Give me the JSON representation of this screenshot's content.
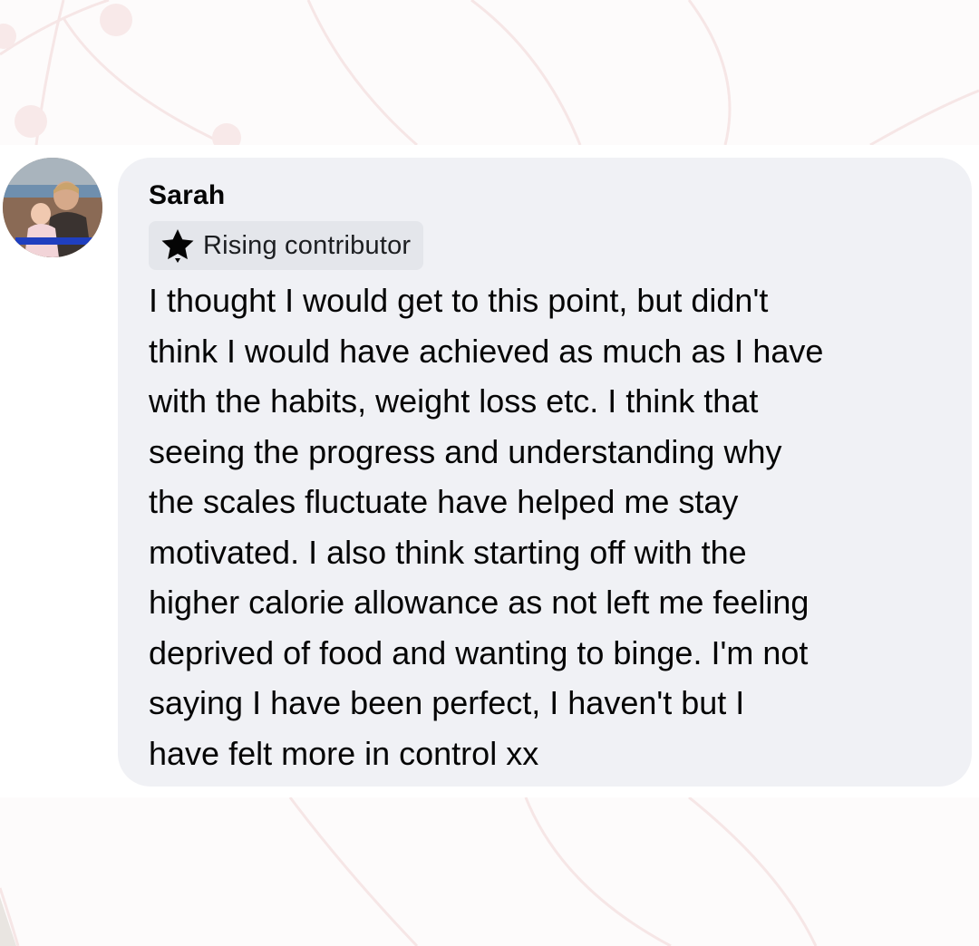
{
  "comment": {
    "author": "Sarah",
    "avatar": "profile-photo",
    "badge": {
      "icon": "star-icon",
      "label": "Rising contributor"
    },
    "text": "I thought I would get to this point, but didn't\nthink I would have achieved as much as I have\nwith the habits, weight loss etc. I think that\nseeing the progress and understanding why\nthe scales fluctuate have helped me stay\nmotivated. I also think starting off with the\nhigher calorie allowance as not left me feeling\ndeprived of food and wanting to binge. I'm not\nsaying I have been perfect, I haven't  but I\nhave felt more in control xx"
  },
  "colors": {
    "bubble_background": "#f0f1f5",
    "badge_background": "#e4e6eb",
    "text": "#050505",
    "decor": "#f5e4e4"
  }
}
